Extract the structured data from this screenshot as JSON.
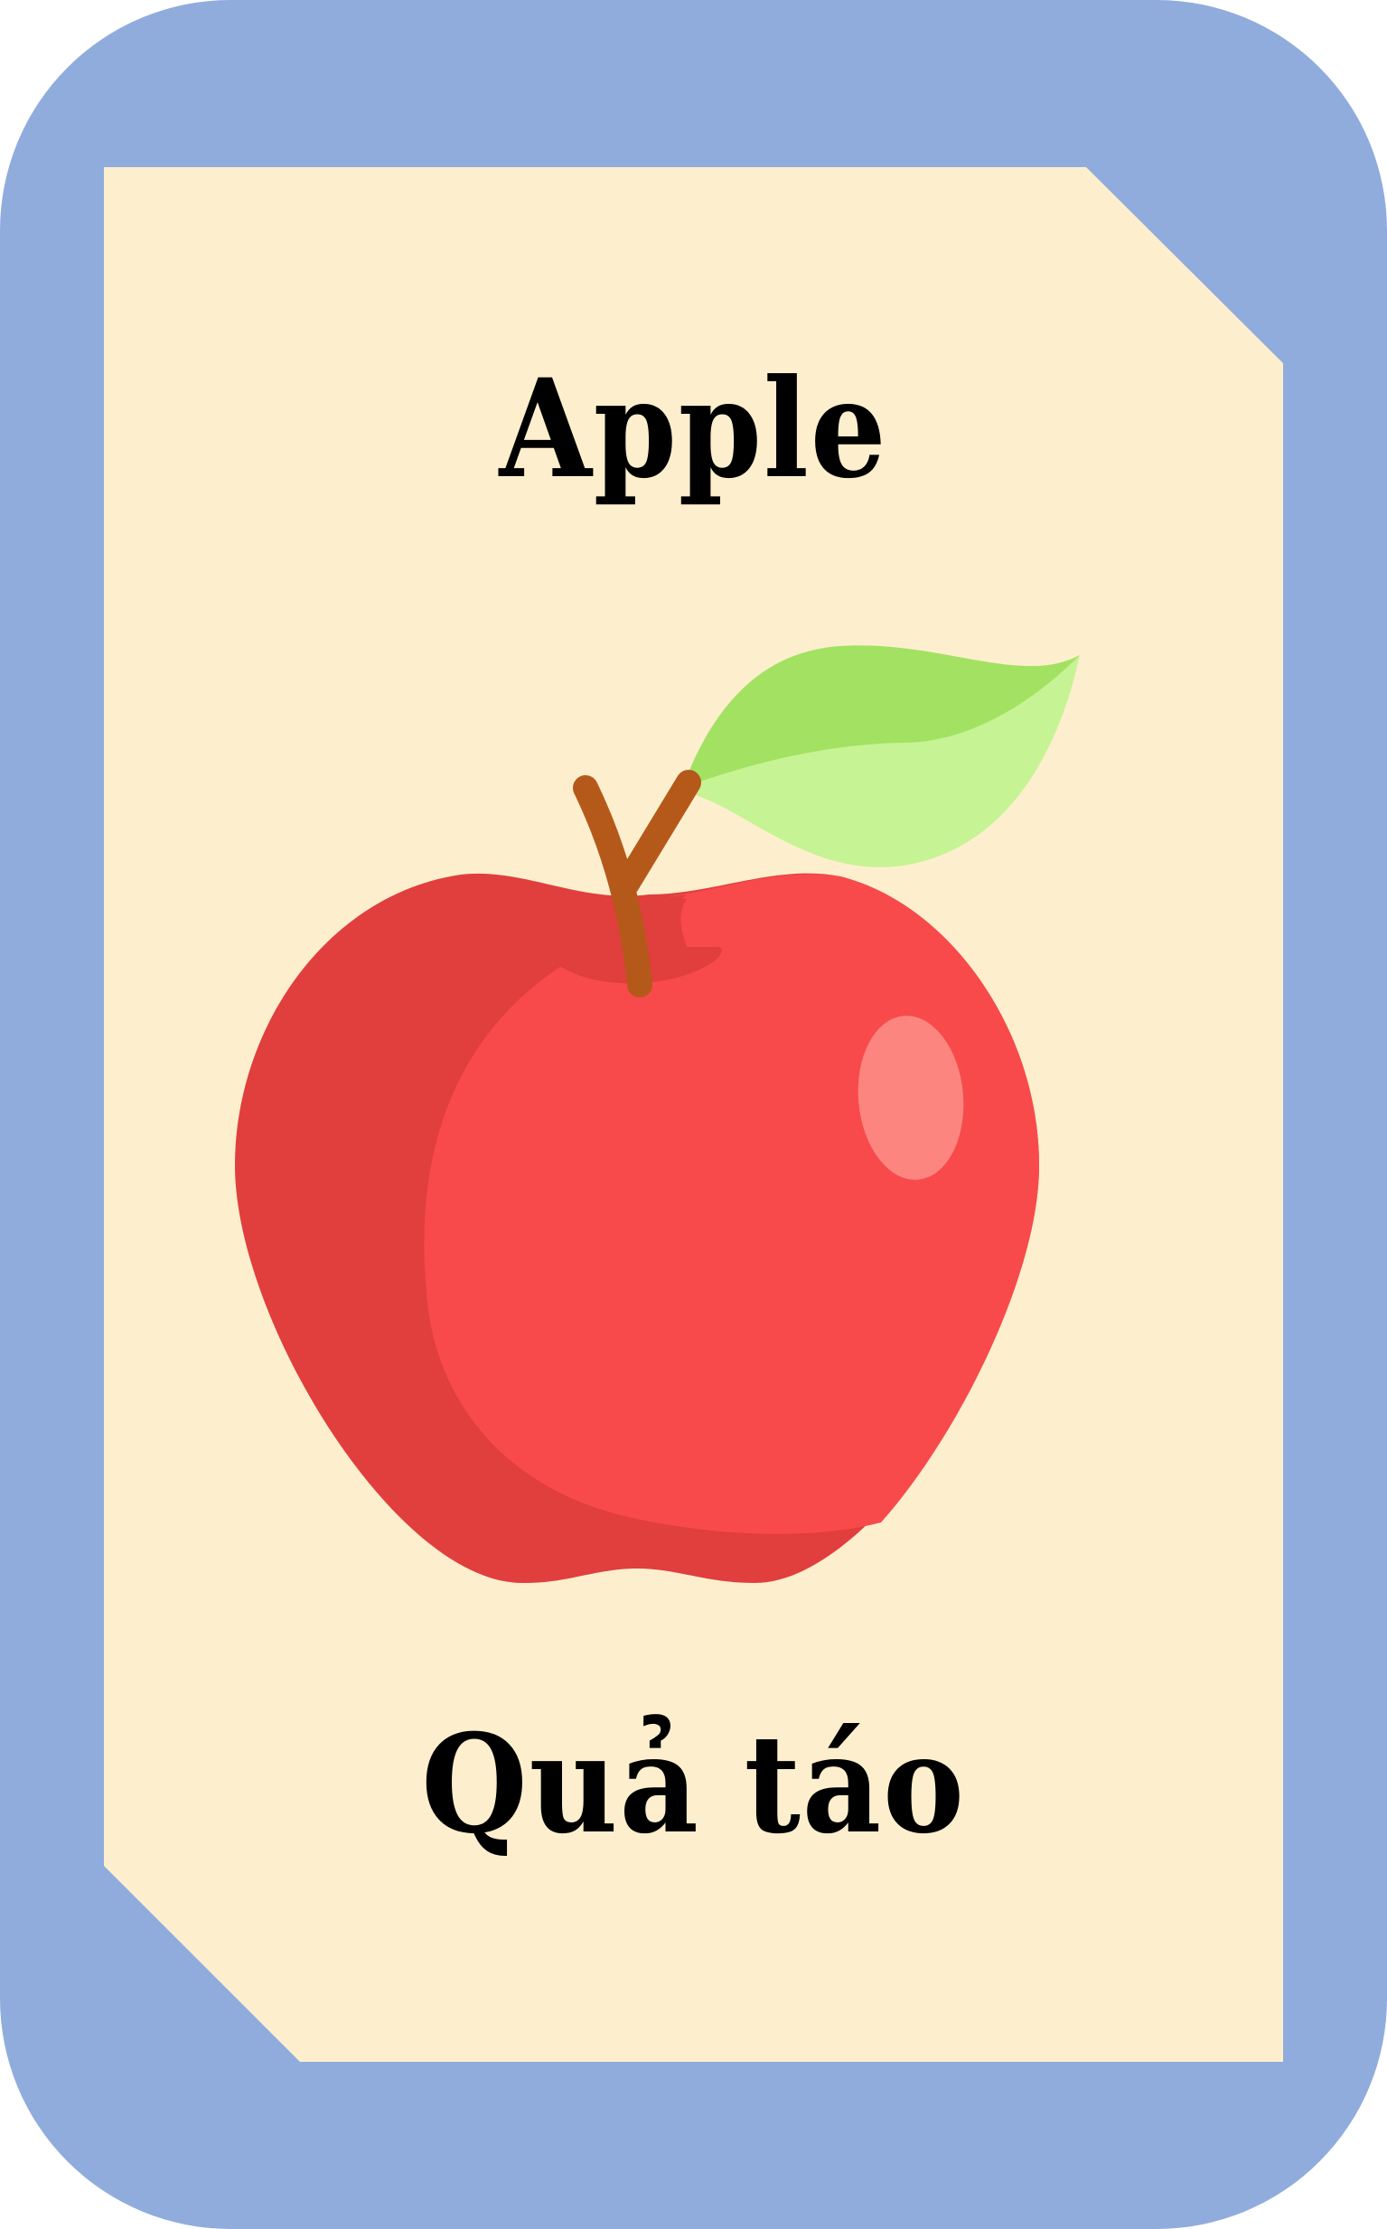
{
  "card": {
    "title_en": "Apple",
    "title_vi": "Quả táo",
    "icon": "apple-icon"
  },
  "colors": {
    "frame": "#90acdd",
    "panel": "#fdefcd",
    "apple_main": "#f84a4b",
    "apple_shadow": "#e13e3e",
    "apple_highlight": "#fd8580",
    "stem": "#b5591b",
    "leaf_dark": "#a3e162",
    "leaf_light": "#c6f394"
  }
}
